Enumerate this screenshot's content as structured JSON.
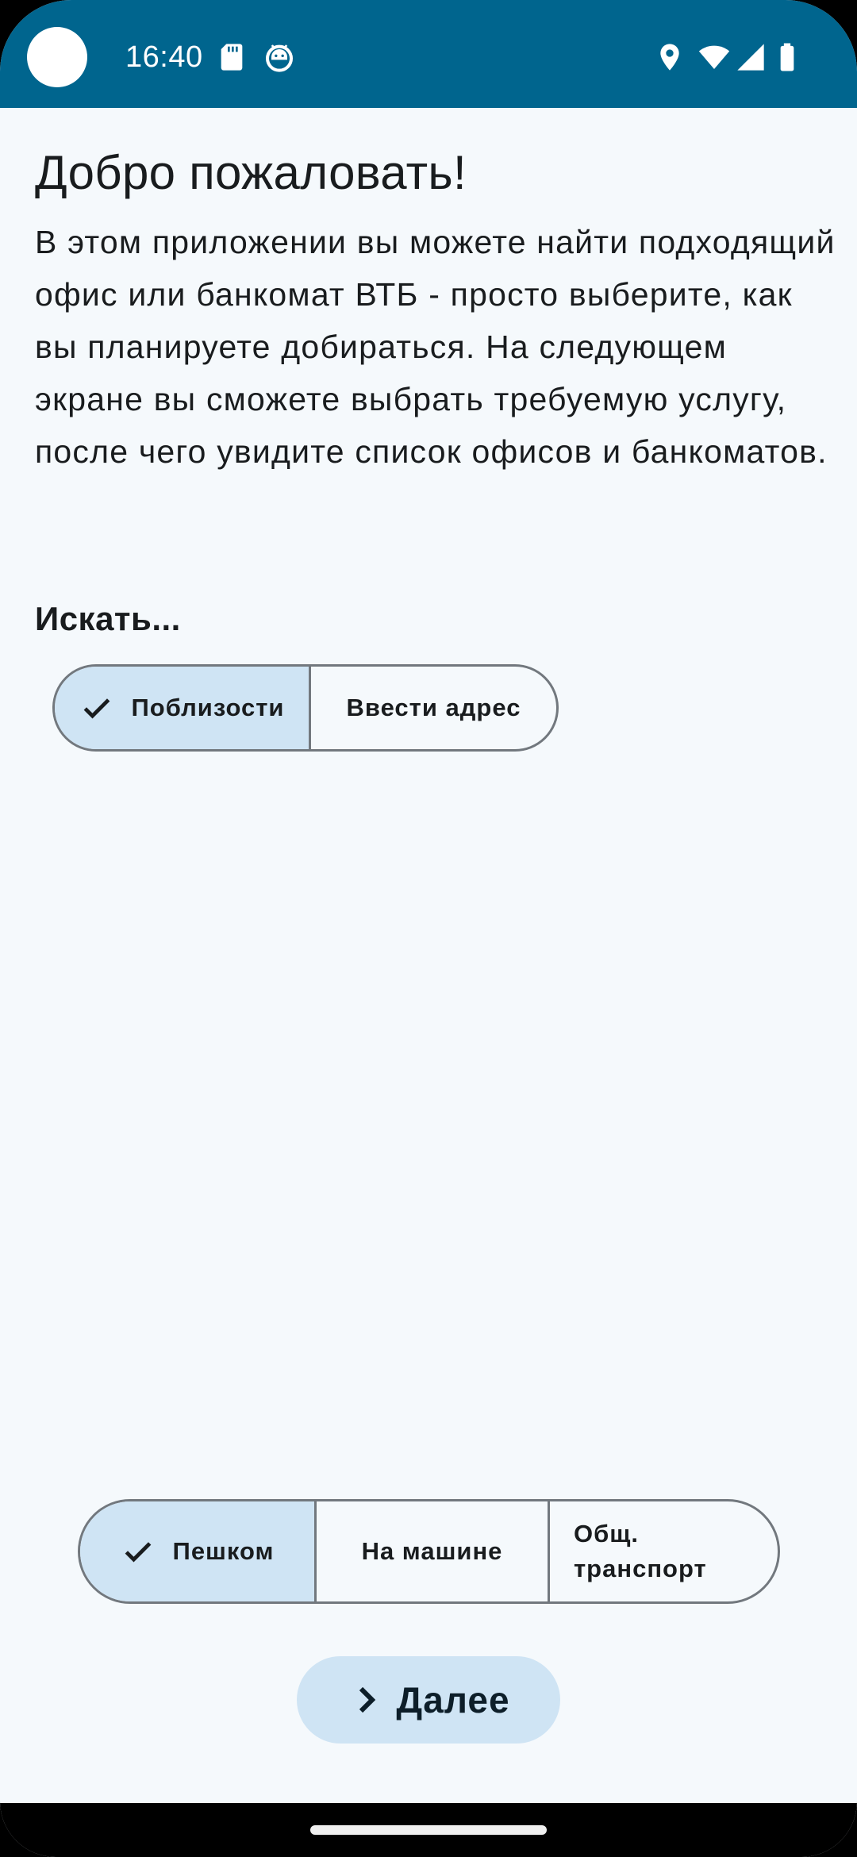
{
  "status_bar": {
    "time": "16:40",
    "left_icons": [
      "sd-card-icon",
      "debug-android-icon"
    ],
    "right_icons": [
      "location-icon",
      "wifi-icon",
      "signal-icon",
      "battery-icon"
    ]
  },
  "welcome": {
    "title": "Добро пожаловать!",
    "text": "В этом приложении вы можете найти подходящий офис или банкомат ВТБ - просто выберите, как вы планируете добираться. На следующем экране вы сможете выбрать требуемую услугу, после чего увидите список офисов и банкоматов."
  },
  "search": {
    "label": "Искать...",
    "options": [
      {
        "label": "Поблизости",
        "selected": true
      },
      {
        "label": "Ввести адрес",
        "selected": false
      }
    ]
  },
  "transport": {
    "options": [
      {
        "label": "Пешком",
        "selected": true
      },
      {
        "label": "На машине",
        "selected": false
      },
      {
        "label": "Общ. транспорт",
        "selected": false
      }
    ]
  },
  "next_button": {
    "label": "Далее",
    "icon": "chevron-right-icon"
  },
  "colors": {
    "status_bar": "#00658e",
    "background": "#f5f9fc",
    "selected_segment": "#cfe4f4",
    "outline": "#72787e",
    "text": "#191c1e"
  }
}
